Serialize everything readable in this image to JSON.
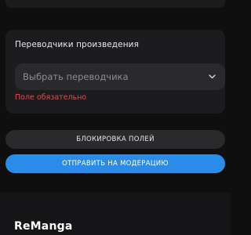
{
  "translators_section": {
    "title": "Переводчики произведения",
    "select_placeholder": "Выбрать переводчика",
    "error": "Поле обязательно"
  },
  "actions": {
    "lock_fields_label": "БЛОКИРОВКА ПОЛЕЙ",
    "submit_label": "ОТПРАВИТЬ НА МОДЕРАЦИЮ"
  },
  "footer": {
    "brand": "ReManga"
  },
  "colors": {
    "background": "#0f0f10",
    "card": "#1c1c1e",
    "error": "#e04b4b",
    "accent": "#2b8be8"
  },
  "icons": {
    "select_chevron": "chevron-down-icon"
  }
}
